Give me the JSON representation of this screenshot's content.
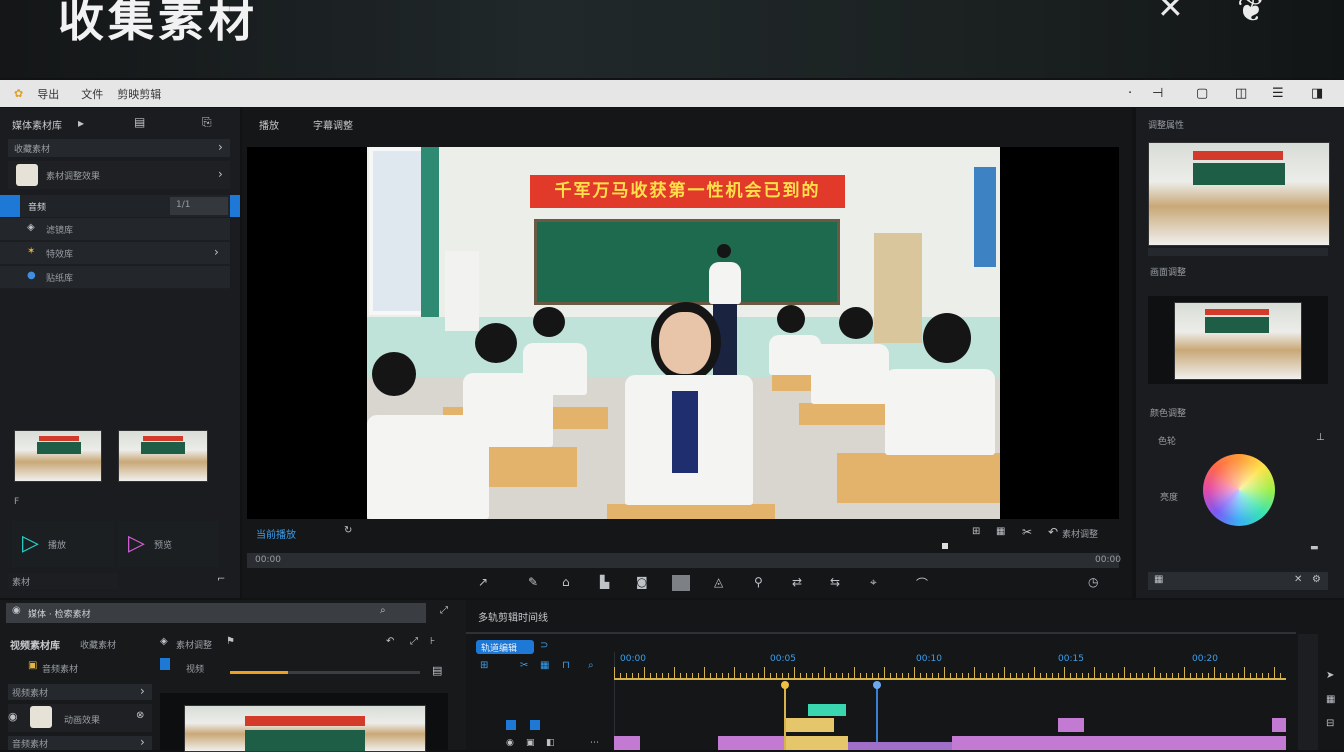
{
  "overlay": {
    "title": "收集素材",
    "close_icon": "✕",
    "leaf_icon": "❦"
  },
  "menubar": {
    "items": [
      "导出",
      "文件",
      "剪映剪辑"
    ],
    "right_icons": [
      "minimize-bar-icon",
      "window-icon",
      "layout-icon",
      "menu-icon"
    ]
  },
  "left_panel": {
    "header": "媒体素材库",
    "section1": "收藏素材",
    "item1": "素材调整效果",
    "selected_item": "音频",
    "selected_value": "1/1",
    "sub_items": [
      "滤镜库",
      "特效库",
      "贴纸库"
    ],
    "label_f": "F",
    "play_buttons": [
      "播放",
      "预览"
    ],
    "footer_label": "素材"
  },
  "preview": {
    "tabs": [
      "播放",
      "字幕调整"
    ],
    "banner_text": "千军万马收获第一性机会已到的",
    "status_label": "当前播放",
    "right_status": "素材调整",
    "timecode_left": "00:00",
    "timecode_right": "00:00"
  },
  "right_panel": {
    "header": "调整属性",
    "label1": "画面调整",
    "label2": "颜色调整",
    "label3": "色轮",
    "label4": "亮度",
    "color_accent": "#7be3d0"
  },
  "bottom_left": {
    "search_bar": "媒体 · 检索素材",
    "project_title": "视频素材库",
    "project_sub": "收藏素材",
    "project_sub2": "音频素材",
    "list_items": [
      "视频素材",
      "动画效果",
      "音频素材"
    ],
    "panel_label": "素材调整",
    "clip_label": "视频"
  },
  "timeline": {
    "title": "多轨剪辑时间线",
    "toggle_label": "轨道编辑",
    "markers": [
      "00:00",
      "00:05",
      "00:10",
      "00:15",
      "00:20"
    ],
    "accent_color": "#d8b24a",
    "clip_color": "#c27ad2"
  }
}
